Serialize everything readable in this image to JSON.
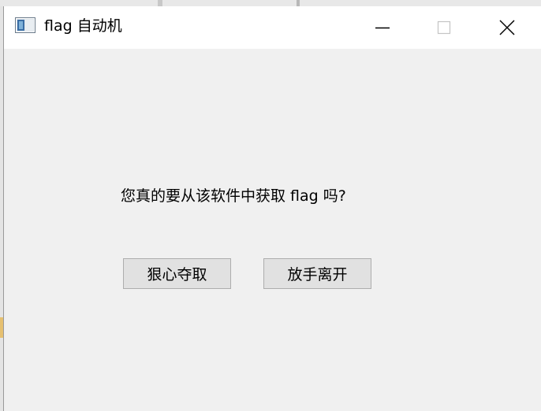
{
  "window": {
    "title": "flag 自动机",
    "controls": {
      "minimize_icon": "minimize-icon",
      "maximize_icon": "maximize-icon",
      "close_icon": "close-icon"
    }
  },
  "dialog": {
    "message": "您真的要从该软件中获取 flag 吗?",
    "buttons": {
      "seize_label": "狠心夺取",
      "leave_label": "放手离开"
    }
  },
  "colors": {
    "titlebar_bg": "#ffffff",
    "client_bg": "#f0f0f0",
    "button_bg": "#e1e1e1",
    "button_border": "#adadad"
  }
}
